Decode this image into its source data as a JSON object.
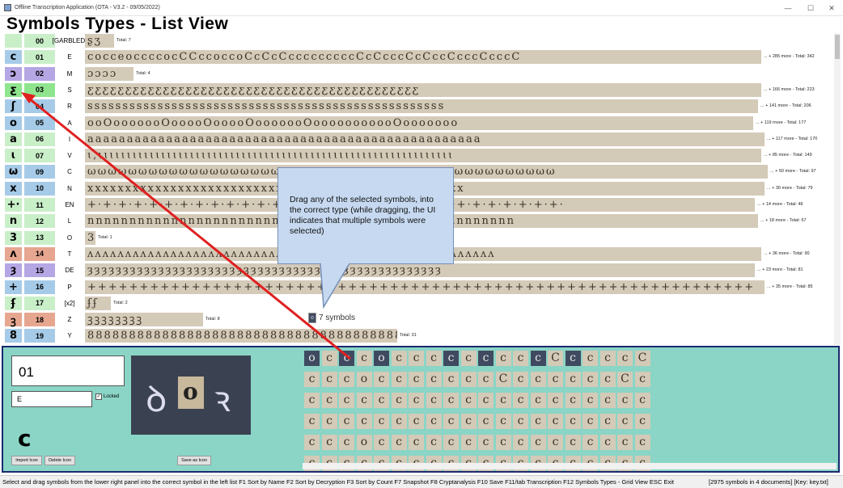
{
  "window": {
    "title": "Offline Transcription Application (OTA - V3.2 - 09/05/2022)",
    "minimize": "—",
    "maximize": "☐",
    "close": "✕"
  },
  "page_title": "Symbols Types - List View",
  "rows": [
    {
      "icon": "",
      "code": "00",
      "type": "[GARBLED]",
      "strip": "ʂʒ",
      "total": "Total: 7",
      "color": "#c9efc9",
      "icon_color": "#c9efc9",
      "strip_w": 36
    },
    {
      "icon": "c",
      "code": "01",
      "type": "E",
      "strip": "cocceoccccocCCccoccoCcCcCcccccccccCcCcccCcCccCcccCcccC",
      "total": "... + 285 more -  Total: 342",
      "color": "#c9efc9",
      "icon_color": "#a6cbe8",
      "strip_w": 836
    },
    {
      "icon": "ɔ",
      "code": "02",
      "type": "M",
      "strip": "ɔɔɔɔ",
      "total": "Total: 4",
      "color": "#b5a6e4",
      "icon_color": "#b5a6e4",
      "strip_w": 60
    },
    {
      "icon": "ƹ",
      "code": "03",
      "type": "S",
      "strip": "ƹƹƹƹƹƹƹƹƹƹƹƹƹƹƹƹƹƹƹƹƹƹƹƹƹƹƹƹƹƹƹƹƹƹƹƹƹƹƹƹƹƹƹƹ",
      "total": "... + 166 more -  Total: 223",
      "color": "#8ee58e",
      "icon_color": "#8ee58e",
      "strip_w": 836
    },
    {
      "icon": "ʃ",
      "code": "04",
      "type": "R",
      "strip": "sssssssssssssssssssssssssssssssssssssssssssssssssss",
      "total": "... + 141 more -  Total: 206",
      "color": "#a6cbe8",
      "icon_color": "#a6cbe8",
      "strip_w": 832
    },
    {
      "icon": "o",
      "code": "05",
      "type": "A",
      "strip": "ooOooooooOooooOooooOooooooOooooooooooOooooooo",
      "total": "... + 119 more -  Total: 177",
      "color": "#a6cbe8",
      "icon_color": "#a6cbe8",
      "strip_w": 826
    },
    {
      "icon": "a",
      "code": "06",
      "type": "I",
      "strip": "aaaaaaaaaaaaaaaaaaaaaaaaaaaaaaaaaaaaaaaaaaaaaaaaaa",
      "total": "... + 117 more -  Total: 170",
      "color": "#c9efc9",
      "icon_color": "#c9efc9",
      "strip_w": 840
    },
    {
      "icon": "ɩ",
      "code": "07",
      "type": "V",
      "strip": "ɩ,ɩɩɩɩɩɩɩɩɩɩɩɩɩɩɩɩɩɩɩɩɩɩɩɩɩɩɩɩɩɩɩɩɩɩɩɩɩɩɩɩɩɩɩɩɩɩɩɩɩɩɩɩɩɩɩɩɩɩɩɩɩɩ",
      "total": "... + 85 more -  Total: 149",
      "color": "#c9efc9",
      "icon_color": "#c9efc9",
      "strip_w": 836
    },
    {
      "icon": "ω",
      "code": "09",
      "type": "C",
      "strip": "ωωωωωωωωωωωωωωωωωωωωωωωωωωωωωωωωωωωωωωωωωωωωωω",
      "total": "... + 50 more -  Total: 97",
      "color": "#a6cbe8",
      "icon_color": "#a6cbe8",
      "strip_w": 844
    },
    {
      "icon": "x",
      "code": "10",
      "type": "N",
      "strip": "xxxxxxxxxxxxxxxxxxxxxxxxxxxxxxxxxxxxxxxxxxxxxxxxxx",
      "total": "... + 30 more -  Total: 79",
      "color": "#a6cbe8",
      "icon_color": "#a6cbe8",
      "strip_w": 840
    },
    {
      "icon": "+·",
      "code": "11",
      "type": "EN",
      "strip": "+·+·+·+·+·+·+·+·+·+·+·+·+·+·+·+·+·+·+·+·+·+·+·+·+·+·+·+·+·+·+·",
      "total": "... + 14 more -  Total: 46",
      "color": "#c9efc9",
      "icon_color": "#c9efc9",
      "strip_w": 828
    },
    {
      "icon": "n",
      "code": "12",
      "type": "L",
      "strip": "nnnnnnnnnnnnnnnnnnnnnnnnnnnnnnnnnnnnnnnnnnnnnnnnnnn",
      "total": "... + 18 more -  Total: 67",
      "color": "#c9efc9",
      "icon_color": "#c9efc9",
      "strip_w": 832
    },
    {
      "icon": "3",
      "code": "13",
      "type": "O",
      "strip": "3",
      "total": "Total: 1",
      "color": "#c9efc9",
      "icon_color": "#c9efc9",
      "strip_w": 13
    },
    {
      "icon": "ʌ",
      "code": "14",
      "type": "T",
      "strip": "ʌʌʌʌʌʌʌʌʌʌʌʌʌʌʌʌʌʌʌʌʌʌʌʌʌʌʌʌʌʌʌʌʌʌʌʌʌʌʌʌʌʌʌʌʌʌʌʌʌʌʌʌʌʌ",
      "total": "... + 36 more -  Total: 90",
      "color": "#e6a690",
      "icon_color": "#e6a690",
      "strip_w": 836
    },
    {
      "icon": "ȝ",
      "code": "15",
      "type": "DE",
      "strip": "ȝȝȝȝȝȝȝȝȝȝȝȝȝȝȝȝȝȝȝȝȝȝȝȝȝȝȝȝȝȝȝȝȝȝȝȝȝȝȝȝȝȝȝȝȝȝȝȝȝȝ",
      "total": "... + 23 more -  Total: 81",
      "color": "#b5a6e4",
      "icon_color": "#b5a6e4",
      "strip_w": 828
    },
    {
      "icon": "+",
      "code": "16",
      "type": "P",
      "strip": "++++++++++++++++++++++++++++++++++++++++++++++++++++++++++++++++",
      "total": "... + 35 more -  Total: 85",
      "color": "#a6cbe8",
      "icon_color": "#a6cbe8",
      "strip_w": 840
    },
    {
      "icon": "ʄ",
      "code": "17",
      "type": "[x2]",
      "strip": "ʄʄ",
      "total": "Total: 2",
      "color": "#c9efc9",
      "icon_color": "#c9efc9",
      "strip_w": 32
    },
    {
      "icon": "ꝫ",
      "code": "18",
      "type": "Z",
      "strip": "ꝫꝫꝫꝫꝫꝫꝫꝫ",
      "total": "Total: 8",
      "color": "#e6a690",
      "icon_color": "#e6a690",
      "strip_w": 146
    },
    {
      "icon": "8",
      "code": "19",
      "type": "Y",
      "strip": "8888888888888888888888888888888888888888",
      "total": "Total: 31",
      "color": "#a6cbe8",
      "icon_color": "#a6cbe8",
      "strip_w": 386
    }
  ],
  "callout": {
    "text": "Drag any of the selected symbols, into the correct type (while dragging, the UI indicates that multiple symbols were selected)"
  },
  "drag_badge": {
    "icon": "o",
    "text": "7 symbols"
  },
  "editor": {
    "name_value": "01",
    "type_value": "E",
    "locked_label": "Locked",
    "locked_checked": "✓",
    "icon_glyph": "c",
    "import_label": "Import Icon",
    "delete_label": "Delete Icon",
    "save_as_icon_label": "Save as Icon"
  },
  "preview": {
    "left": "ꝺ",
    "center": "o",
    "right": "ꝛ"
  },
  "grid_rows": [
    "occcocccccccccCccccC",
    "cccocccccccCccccccCc",
    "cccccccccccccccccccc",
    "cccccccccccccccccccc",
    "cccoccccccccccccccccc",
    "ccccccccccccccccccccc"
  ],
  "grid_selected": [
    0,
    2,
    4,
    8,
    10,
    13,
    15
  ],
  "status": {
    "left": "Select and drag symbols from the lower right panel into the correct symbol in the left list F1 Sort by Name F2 Sort by Decryption F3 Sort by Count F7 Snapshot F8 Cryptanalysis F10 Save F11/tab Transcription F12 Symbols Types - Grid View ESC Exit",
    "right": "[2975 symbols in 4 documents] [Key: key.txt]"
  }
}
